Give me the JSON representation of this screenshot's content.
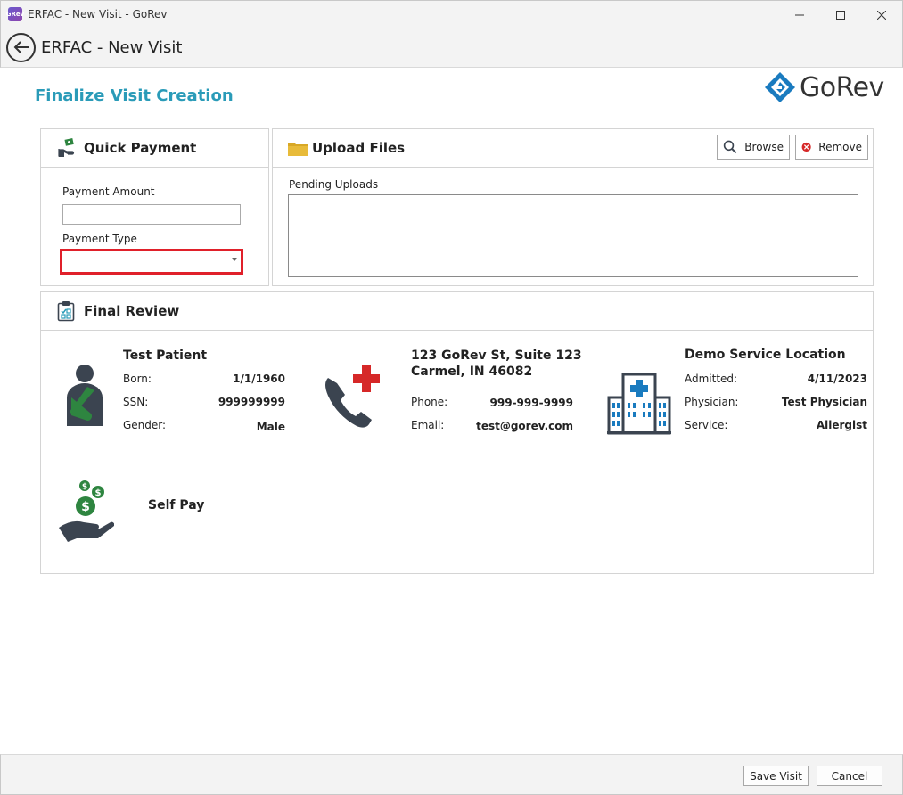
{
  "window": {
    "title": "ERFAC - New Visit - GoRev",
    "app_icon_text": "GRev"
  },
  "header": {
    "title": "ERFAC - New Visit"
  },
  "page": {
    "title": "Finalize Visit Creation"
  },
  "logo": {
    "text": "GoRev",
    "color": "#1a7bbf"
  },
  "quick_payment": {
    "title": "Quick Payment",
    "amount_label": "Payment Amount",
    "amount_value": "",
    "type_label": "Payment Type",
    "type_value": ""
  },
  "upload_files": {
    "title": "Upload Files",
    "browse_label": "Browse",
    "remove_label": "Remove",
    "pending_label": "Pending Uploads"
  },
  "final_review": {
    "title": "Final Review",
    "patient": {
      "name": "Test Patient",
      "born_label": "Born:",
      "born": "1/1/1960",
      "ssn_label": "SSN:",
      "ssn": "999999999",
      "gender_label": "Gender:",
      "gender": "Male"
    },
    "contact": {
      "address_line1": "123 GoRev St, Suite 123",
      "address_line2": "Carmel, IN 46082",
      "phone_label": "Phone:",
      "phone": "999-999-9999",
      "email_label": "Email:",
      "email": "test@gorev.com"
    },
    "location": {
      "name": "Demo Service Location",
      "admitted_label": "Admitted:",
      "admitted": "4/11/2023",
      "physician_label": "Physician:",
      "physician": "Test Physician",
      "service_label": "Service:",
      "service": "Allergist"
    },
    "payer": {
      "name": "Self Pay"
    }
  },
  "footer": {
    "save_label": "Save Visit",
    "cancel_label": "Cancel"
  },
  "colors": {
    "accent": "#2a9bb8",
    "highlight_border": "#e0202a",
    "icon_dark": "#3b4450",
    "icon_green": "#2e8540",
    "icon_red": "#d62828",
    "folder_yellow": "#d8a826"
  }
}
